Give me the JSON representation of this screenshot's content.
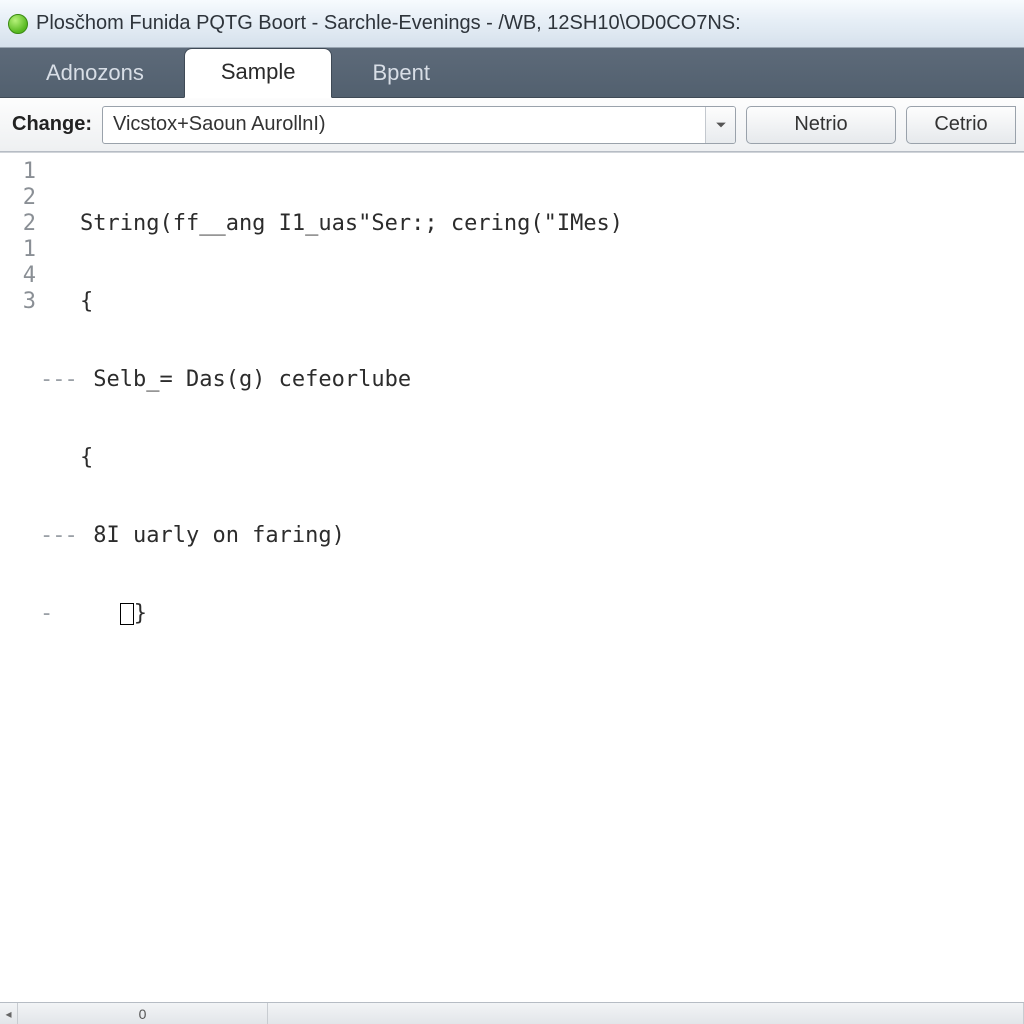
{
  "window": {
    "title": "Plosčhom Funida PQTG Boort - Sarchle-Evenings - /WB, 12SH10\\OD0CO7NS:"
  },
  "tabs": [
    {
      "label": "Adnozons",
      "active": false
    },
    {
      "label": "Sample",
      "active": true
    },
    {
      "label": "Bpent",
      "active": false
    }
  ],
  "toolbar": {
    "change_label": "Change:",
    "change_value": "Vicstox+Saoun AurollnI)",
    "button1": "Netrio",
    "button2": "Cetrio"
  },
  "editor": {
    "gutter": [
      "1",
      "2",
      "2",
      "1",
      "4",
      "3"
    ],
    "lines": [
      {
        "fold": "",
        "text": "String(ff__ang I1_uas\"Ser:; cering(\"IMes)"
      },
      {
        "fold": "",
        "text": "{"
      },
      {
        "fold": "---",
        "text": " Selb_= Das(g) cefeorlube"
      },
      {
        "fold": "",
        "text": "{"
      },
      {
        "fold": "---",
        "text": " 8I uarly on faring)"
      },
      {
        "fold": "-",
        "text": "   ",
        "cursor": true,
        "tail": "}"
      }
    ]
  },
  "statusbar": {
    "cell1": "0",
    "scroll_left": "◂"
  }
}
